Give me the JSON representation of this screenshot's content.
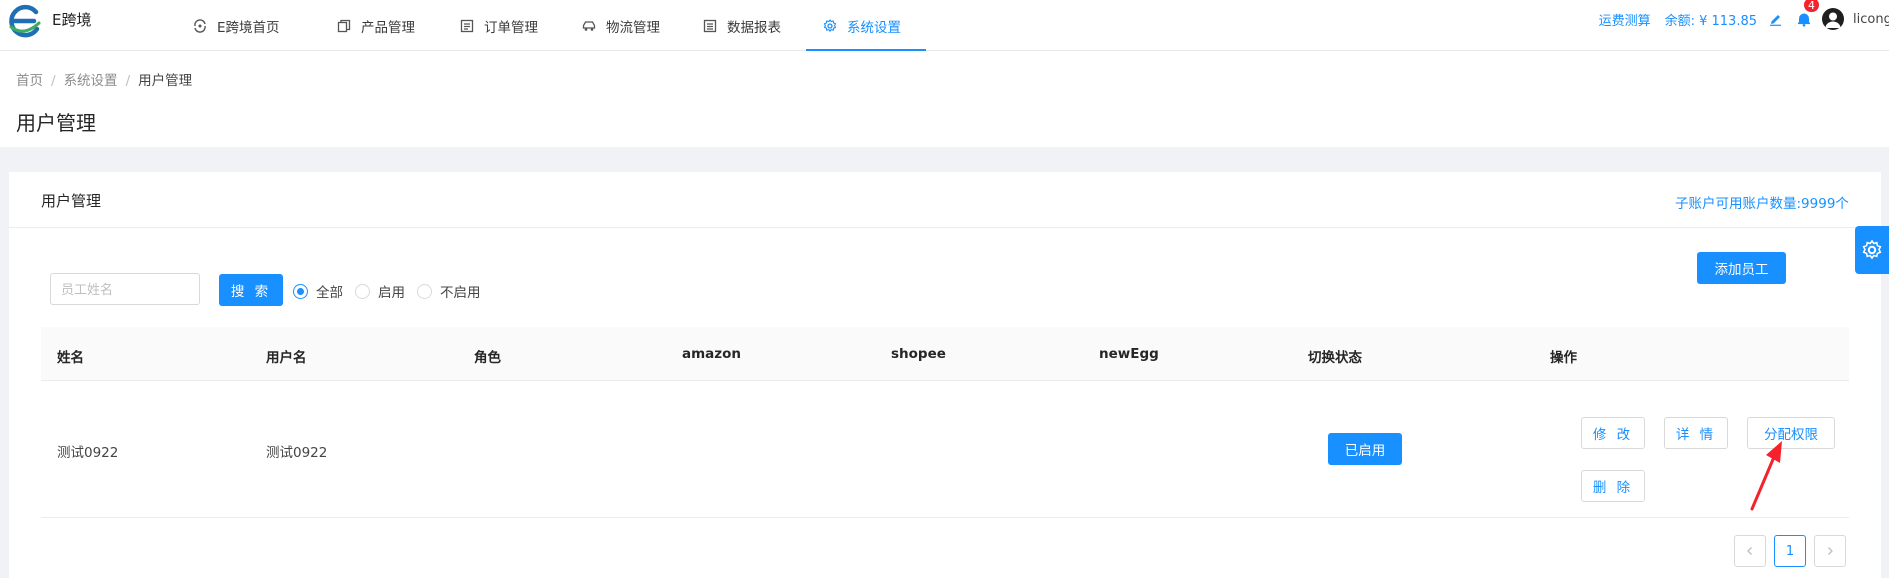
{
  "brand": {
    "name": "E跨境"
  },
  "nav": {
    "items": [
      {
        "label": "E跨境首页",
        "icon": "home-swirl-icon"
      },
      {
        "label": "产品管理",
        "icon": "copy-icon"
      },
      {
        "label": "订单管理",
        "icon": "list-icon"
      },
      {
        "label": "物流管理",
        "icon": "car-icon"
      },
      {
        "label": "数据报表",
        "icon": "report-icon"
      },
      {
        "label": "系统设置",
        "icon": "gear-icon"
      }
    ],
    "active": "系统设置"
  },
  "header_right": {
    "freight_calc": "运费测算",
    "balance": "余额: ¥ 113.85",
    "notification_count": "4",
    "username": "licong"
  },
  "breadcrumb": {
    "home": "首页",
    "parent": "系统设置",
    "current": "用户管理"
  },
  "page": {
    "title": "用户管理"
  },
  "card": {
    "title": "用户管理",
    "quota": "子账户可用账户数量:9999个"
  },
  "filter": {
    "search_placeholder": "员工姓名",
    "search_button": "搜 索",
    "radios": [
      {
        "label": "全部",
        "checked": true
      },
      {
        "label": "启用",
        "checked": false
      },
      {
        "label": "不启用",
        "checked": false
      }
    ],
    "add_button": "添加员工"
  },
  "table": {
    "columns": [
      "姓名",
      "用户名",
      "角色",
      "amazon",
      "shopee",
      "newEgg",
      "切换状态",
      "操作"
    ],
    "rows": [
      {
        "name": "测试0922",
        "username": "测试0922",
        "role": "",
        "amazon": "",
        "shopee": "",
        "newegg": "",
        "state_button": "已启用",
        "actions": {
          "edit": "修 改",
          "detail": "详 情",
          "permission": "分配权限",
          "delete": "删 除"
        }
      }
    ]
  },
  "pagination": {
    "current": "1",
    "prev_icon": "chevron-left-icon",
    "next_icon": "chevron-right-icon"
  },
  "colors": {
    "primary": "#1890ff",
    "badge": "#f5222d",
    "annotation_arrow": "#f5222d"
  }
}
